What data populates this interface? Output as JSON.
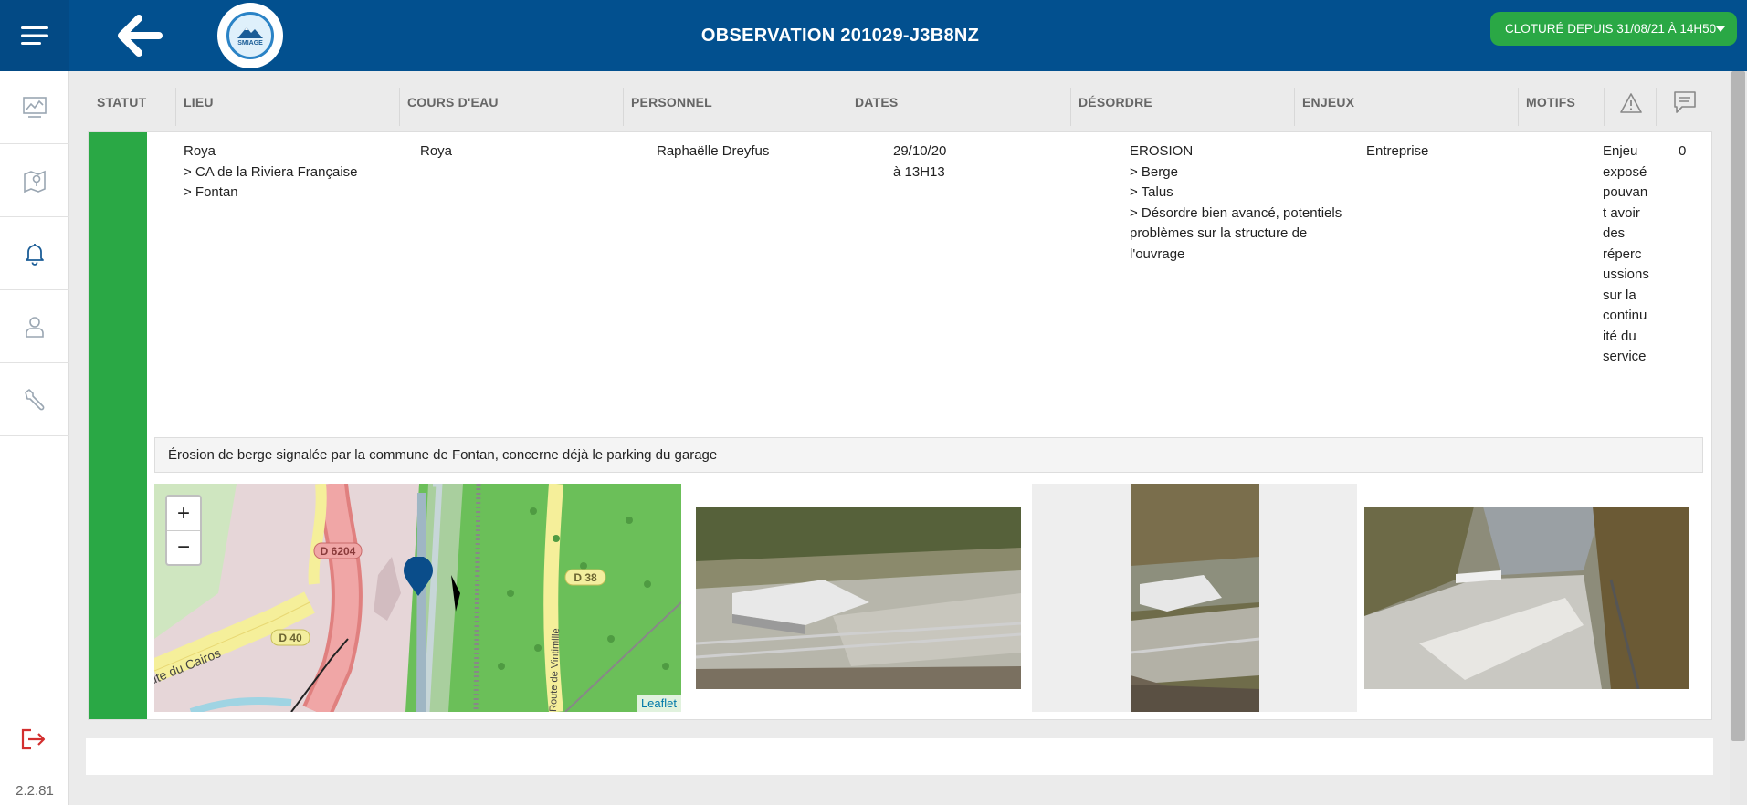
{
  "header": {
    "title": "OBSERVATION 201029-J3B8NZ",
    "logo_text": "SMIAGE",
    "status": "CLOTURÉ DEPUIS 31/08/21 À 14H50"
  },
  "sidebar": {
    "items": [
      {
        "icon": "chart-icon"
      },
      {
        "icon": "map-icon"
      },
      {
        "icon": "bell-icon"
      },
      {
        "icon": "user-icon"
      },
      {
        "icon": "wrench-icon"
      }
    ],
    "version": "2.2.81"
  },
  "table": {
    "columns": {
      "statut": "STATUT",
      "lieu": "LIEU",
      "cours": "COURS D'EAU",
      "personnel": "PERSONNEL",
      "dates": "DATES",
      "desordre": "DÉSORDRE",
      "enjeux": "ENJEUX",
      "motifs": "MOTIFS"
    },
    "row": {
      "lieu": [
        "Roya",
        "> CA de la Riviera Française",
        "> Fontan"
      ],
      "cours": "Roya",
      "personnel": "Raphaëlle Dreyfus",
      "dates": [
        "29/10/20",
        "à 13H13"
      ],
      "desordre": [
        "EROSION",
        "> Berge",
        "> Talus",
        "> Désordre bien avancé, potentiels",
        "problèmes sur la structure de",
        "l'ouvrage"
      ],
      "enjeux": "Entreprise",
      "motifs": [
        "Enjeu",
        "exposé",
        "pouvan",
        "t avoir",
        "des",
        "réperc",
        "ussions",
        "sur la",
        "continu",
        "ité du",
        "service"
      ],
      "comments_count": "0",
      "comment": "Érosion de berge signalée par la commune de Fontan, concerne déjà le parking du garage"
    }
  },
  "map": {
    "zoom_in": "+",
    "zoom_out": "−",
    "attribution": "Leaflet",
    "labels": {
      "d6204": "D 6204",
      "d38": "D 38",
      "d40": "D 40",
      "cairos": "Route du Cairos",
      "vintimille": "Route de Vintimille"
    }
  },
  "colors": {
    "header": "#02508f",
    "status_green": "#2aa845",
    "forest": "#6bbf59"
  }
}
